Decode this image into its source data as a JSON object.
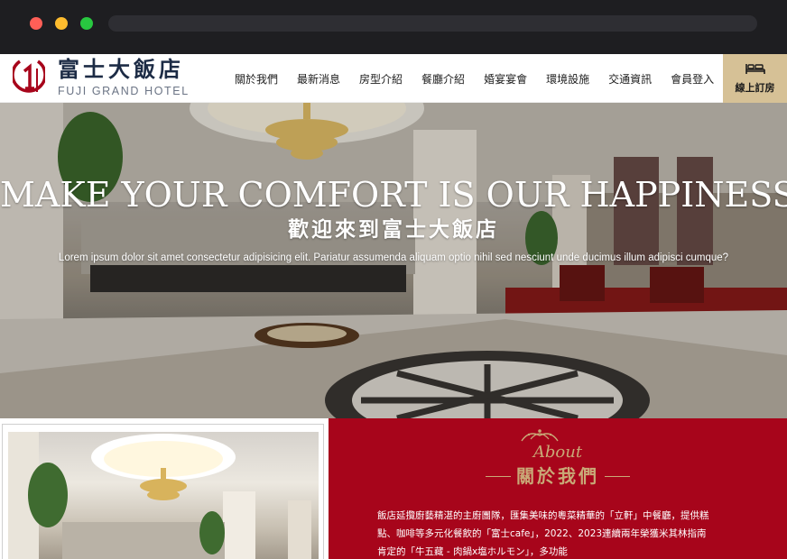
{
  "header": {
    "logo_cn": "富士大飯店",
    "logo_en": "FUJI GRAND HOTEL",
    "nav": [
      "關於我們",
      "最新消息",
      "房型介紹",
      "餐廳介紹",
      "婚宴宴會",
      "環境設施",
      "交通資訊",
      "會員登入"
    ],
    "book_label": "線上訂房"
  },
  "hero": {
    "tagline": "MAKE YOUR COMFORT IS OUR HAPPINESS",
    "title": "歡迎來到富士大飯店",
    "description": "Lorem ipsum dolor sit amet consectetur adipisicing elit. Pariatur assumenda aliquam optio nihil sed nesciunt unde ducimus illum adipisci cumque?"
  },
  "about": {
    "heading_en": "About",
    "heading_cn": "關於我們",
    "paragraph": "飯店延攬廚藝精湛的主廚團隊，匯集美味的粵菜精華的「立軒」中餐廳，提供糕點、咖啡等多元化餐飲的「富士cafe」，2022、2023連續兩年榮獲米其林指南肯定的「牛五藏 - 肉鍋x塩ホルモン」，多功能"
  },
  "colors": {
    "brand_navy": "#1c2b45",
    "brand_red": "#a7051b",
    "accent_gold": "#d6c196",
    "about_gold": "#c9a977"
  },
  "icons": {
    "book": "bed-icon",
    "ornament": "crown-ornament-icon"
  }
}
